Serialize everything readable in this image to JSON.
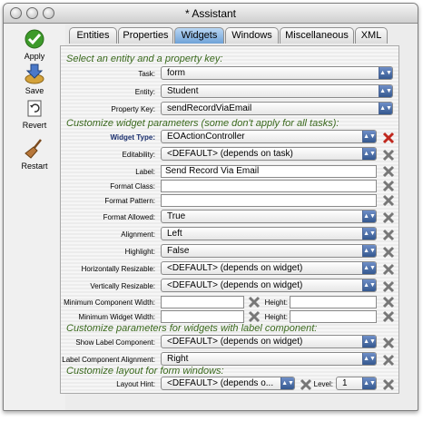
{
  "window": {
    "title": "* Assistant"
  },
  "toolbar": [
    {
      "label": "Apply",
      "icon": "checkmark-icon"
    },
    {
      "label": "Save",
      "icon": "save-arrow-icon"
    },
    {
      "label": "Revert",
      "icon": "revert-icon"
    },
    {
      "label": "Restart",
      "icon": "broom-icon"
    }
  ],
  "tabs": [
    "Entities",
    "Properties",
    "Widgets",
    "Windows",
    "Miscellaneous",
    "XML"
  ],
  "active_tab": "Widgets",
  "sections": {
    "select": "Select an entity and a property key:",
    "customize_widget": "Customize widget parameters (some don't apply for all tasks):",
    "label_component": "Customize parameters for widgets with label component:",
    "form_windows": "Customize layout for form windows:"
  },
  "select": {
    "task_label": "Task:",
    "task_value": "form",
    "entity_label": "Entity:",
    "entity_value": "Student",
    "propkey_label": "Property Key:",
    "propkey_value": "sendRecordViaEmail"
  },
  "widget": {
    "widget_type_label": "Widget Type:",
    "widget_type_value": "EOActionController",
    "editability_label": "Editability:",
    "editability_value": "<DEFAULT> (depends on task)",
    "label_label": "Label:",
    "label_value": "Send Record Via Email",
    "format_class_label": "Format Class:",
    "format_class_value": "",
    "format_pattern_label": "Format Pattern:",
    "format_pattern_value": "",
    "format_allowed_label": "Format Allowed:",
    "format_allowed_value": "True",
    "alignment_label": "Alignment:",
    "alignment_value": "Left",
    "highlight_label": "Highlight:",
    "highlight_value": "False",
    "hresize_label": "Horizontally Resizable:",
    "hresize_value": "<DEFAULT> (depends on widget)",
    "vresize_label": "Vertically Resizable:",
    "vresize_value": "<DEFAULT> (depends on widget)",
    "min_comp_width_label": "Minimum Component Width:",
    "min_comp_width_value": "",
    "min_comp_height_label": "Height:",
    "min_comp_height_value": "",
    "min_widget_width_label": "Minimum Widget Width:",
    "min_widget_width_value": "",
    "min_widget_height_label": "Height:",
    "min_widget_height_value": ""
  },
  "labelcomp": {
    "show_label": "Show Label Component:",
    "show_value": "<DEFAULT> (depends on widget)",
    "align_label": "Label Component Alignment:",
    "align_value": "Right"
  },
  "form": {
    "hint_label": "Layout Hint:",
    "hint_value": "<DEFAULT> (depends o...",
    "level_label": "Level:",
    "level_value": "1"
  },
  "colors": {
    "section": "#3b6a1e",
    "tab_active": "#8db8e6",
    "popup_arrow": "#34588f",
    "delete_red": "#c0281e"
  }
}
